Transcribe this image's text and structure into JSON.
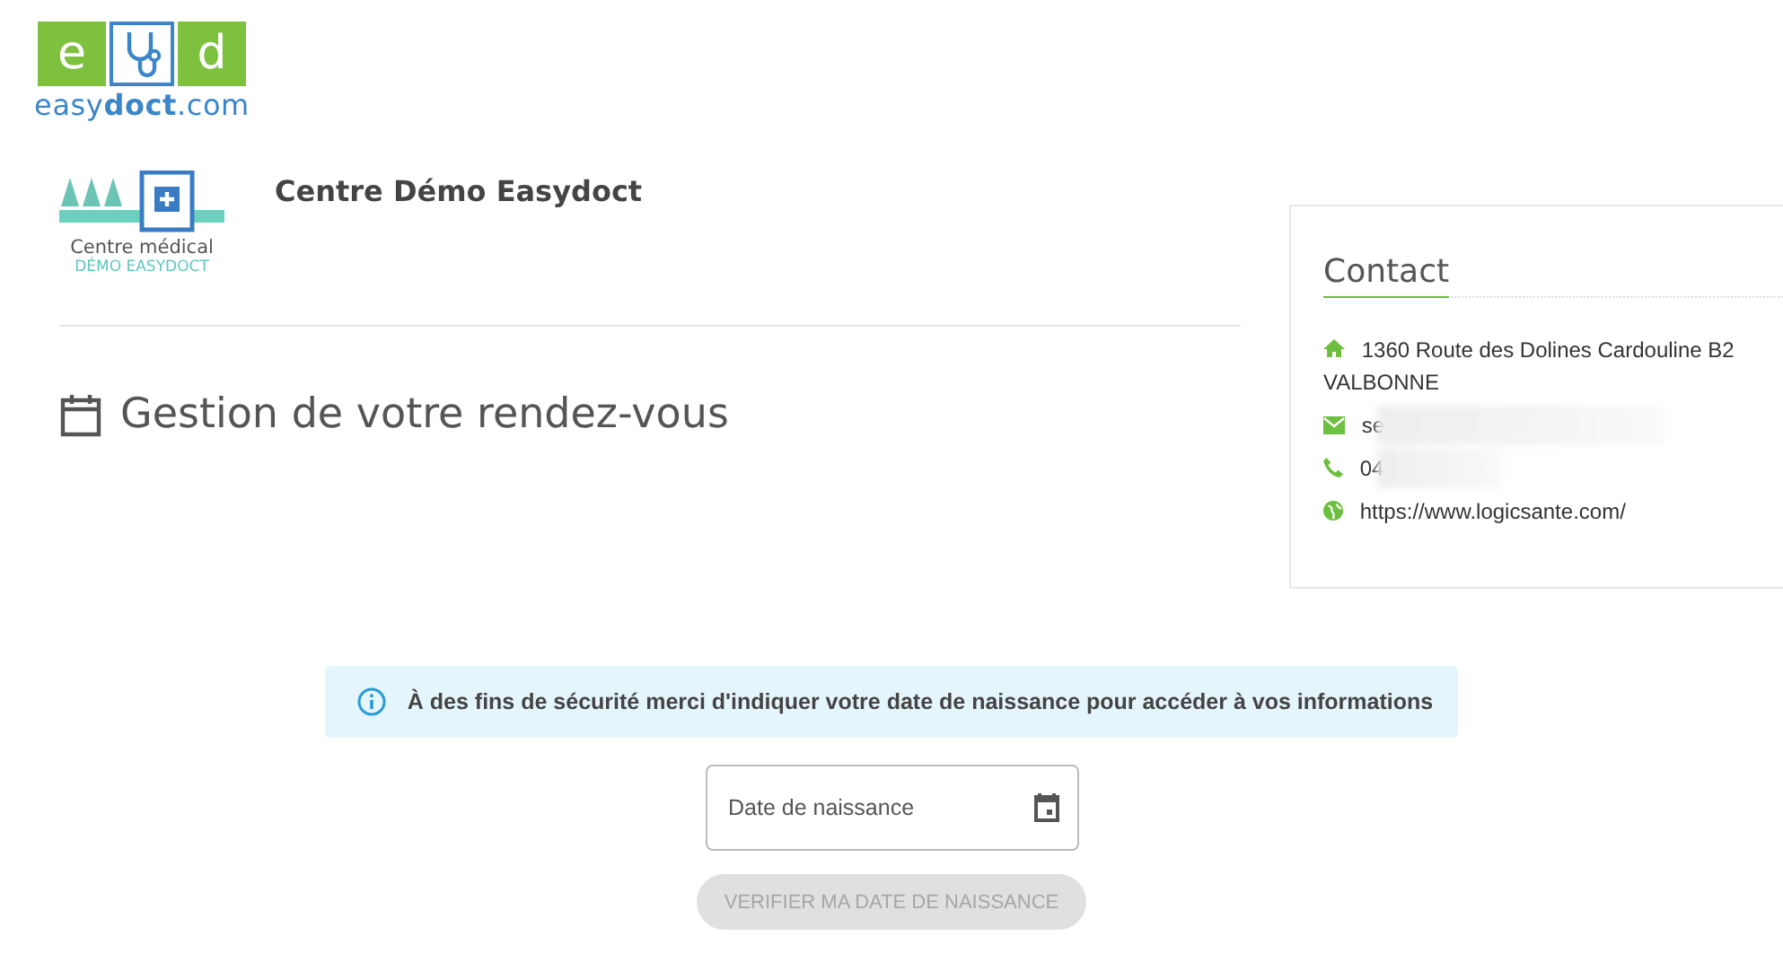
{
  "site_logo": {
    "left_letter": "e",
    "right_letter": "d",
    "wordmark_prefix": "easy",
    "wordmark_bold": "doct",
    "wordmark_suffix": ".com"
  },
  "clinic": {
    "logo_line_1": "Centre médical",
    "logo_line_2": "DÉMO EASYDOCT",
    "name": "Centre Démo Easydoct"
  },
  "page_title": "Gestion de votre rendez-vous",
  "contact": {
    "title": "Contact",
    "items": [
      {
        "kind": "address",
        "text": "1360 Route des Dolines Cardouline B2",
        "line_2": "VALBONNE",
        "redacted": false
      },
      {
        "kind": "email",
        "text": "se",
        "redacted": true
      },
      {
        "kind": "phone",
        "text": "04",
        "redacted": true
      },
      {
        "kind": "web",
        "text": "https://www.logicsante.com/",
        "redacted": false
      }
    ]
  },
  "alert": {
    "text": "À des fins de sécurité merci d'indiquer votre date de naissance pour accéder à vos informations"
  },
  "birth_date_field": {
    "placeholder": "Date de naissance"
  },
  "verify_button": {
    "label": "VERIFIER MA DATE DE NAISSANCE",
    "disabled": true
  }
}
